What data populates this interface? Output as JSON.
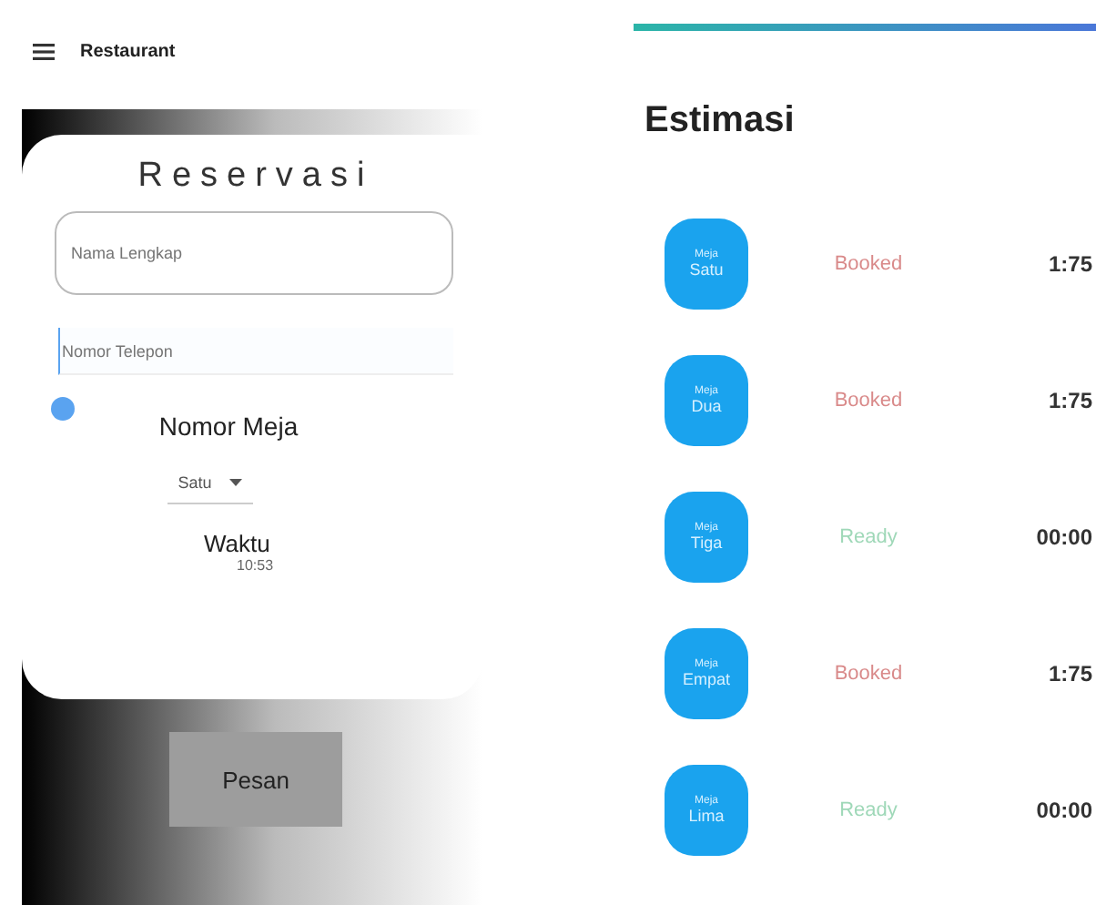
{
  "left": {
    "app_bar": {
      "title": "Restaurant"
    },
    "form": {
      "title": "Reservasi",
      "name_field": {
        "placeholder": "Nama Lengkap"
      },
      "phone_field": {
        "placeholder": "Nomor Telepon",
        "focused": true
      },
      "table_label": "Nomor Meja",
      "table_select": {
        "value": "Satu"
      },
      "time_label": "Waktu",
      "time_value": "10:53"
    },
    "submit_button": "Pesan"
  },
  "right": {
    "title": "Estimasi",
    "tables": [
      {
        "caption": "Meja",
        "name": "Satu",
        "status": "Booked",
        "kind": "booked",
        "time": "1:75"
      },
      {
        "caption": "Meja",
        "name": "Dua",
        "status": "Booked",
        "kind": "booked",
        "time": "1:75"
      },
      {
        "caption": "Meja",
        "name": "Tiga",
        "status": "Ready",
        "kind": "ready",
        "time": "00:00"
      },
      {
        "caption": "Meja",
        "name": "Empat",
        "status": "Booked",
        "kind": "booked",
        "time": "1:75"
      },
      {
        "caption": "Meja",
        "name": "Lima",
        "status": "Ready",
        "kind": "ready",
        "time": "00:00"
      }
    ]
  }
}
